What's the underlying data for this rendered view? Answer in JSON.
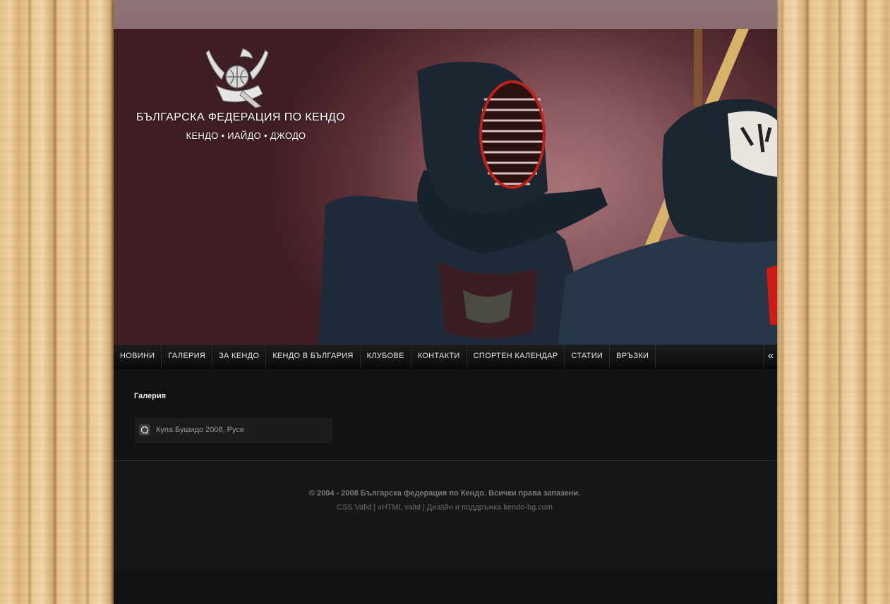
{
  "header": {
    "logo_title": "БЪЛГАРСКА ФЕДЕРАЦИЯ ПО КЕНДО",
    "logo_subtitle": "КЕНДО • ИАЙДО • ДЖОДО"
  },
  "nav": {
    "items": [
      "НОВИНИ",
      "ГАЛЕРИЯ",
      "ЗА КЕНДО",
      "КЕНДО В БЪЛГАРИЯ",
      "КЛУБОВЕ",
      "КОНТАКТИ",
      "СПОРТЕН КАЛЕНДАР",
      "СТАТИИ",
      "ВРЪЗКИ"
    ],
    "collapse_icon": "«"
  },
  "content": {
    "heading": "Галерия",
    "gallery_items": [
      "Купа Бушидо 2008, Русе"
    ]
  },
  "footer": {
    "copyright": "© 2004 - 2008 Българска федерация по Кендо. Всички права запазени.",
    "link_css": "CSS Valid",
    "link_xhtml": "xHTML valid",
    "credit": "Дизайн и поддръжка kendo-bg.com",
    "separator": " | "
  },
  "colors": {
    "page_bg": "#111111",
    "header_bg": "#5e3138",
    "topbar": "#8f7478",
    "nav_text": "#e6e6e6"
  }
}
